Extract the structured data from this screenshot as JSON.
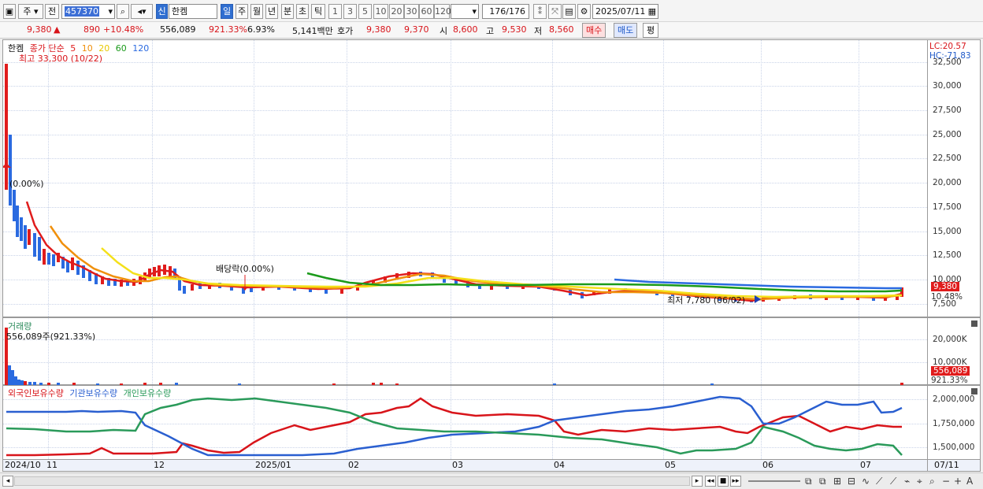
{
  "toolbar": {
    "period_label": "주",
    "prev_label": "전",
    "code_value": "457370",
    "credit_badge": "신",
    "stock_name": "한켐",
    "timeframes": [
      "일",
      "주",
      "월",
      "년",
      "분",
      "초",
      "틱"
    ],
    "intervals": [
      "1",
      "3",
      "5",
      "10",
      "20",
      "30",
      "60",
      "120"
    ],
    "count_value": "176",
    "count_total": "/176",
    "date_value": "2025/07/11"
  },
  "quote": {
    "price": "9,380",
    "change_arrow": "▲",
    "change": "890",
    "change_pct": "+10.48%",
    "volume": "556,089",
    "volume_pct": "921.33%",
    "turnover": "6.93%",
    "amount": "5,141백만",
    "bid_label": "호가",
    "bid1": "9,380",
    "bid2": "9,370",
    "open_label": "시",
    "open": "8,600",
    "high_label": "고",
    "high": "9,530",
    "low_label": "저",
    "low": "8,560",
    "buy_label": "매수",
    "sell_label": "매도",
    "eval_label": "평"
  },
  "price_panel": {
    "stock_name": "한켐",
    "ma_label": "종가 단순",
    "ma_periods": [
      "5",
      "10",
      "20",
      "60",
      "120"
    ],
    "ma_colors": [
      "#e01c1c",
      "#f0900c",
      "#f4e01a",
      "#1a9a1a",
      "#2a6ae0"
    ],
    "high_note": "최고 33,300 (10/22)",
    "pct_note": "(0.00%)",
    "dividend_note": "배당락(0.00%)",
    "low_note": "최저 7,780 (06/02)",
    "lc": "LC:20.57",
    "hc": "HC:-71.83",
    "current_price": "9,380",
    "current_pct": "10.48%",
    "y_ticks": [
      "32,500",
      "30,000",
      "27,500",
      "25,000",
      "22,500",
      "20,000",
      "17,500",
      "15,000",
      "12,500",
      "10,000",
      "7,500"
    ]
  },
  "volume_panel": {
    "title": "거래량",
    "note": "556,089주(921.33%)",
    "y_ticks": [
      "20,000K",
      "10,000K"
    ],
    "current": "556,089",
    "current_pct": "921.33%"
  },
  "holding_panel": {
    "legend": [
      {
        "label": "외국인보유수량",
        "color": "#d8141a"
      },
      {
        "label": "기관보유수량",
        "color": "#2a5fd0"
      },
      {
        "label": "개인보유수량",
        "color": "#2a9a5a"
      }
    ],
    "y_ticks": [
      "2,000,000",
      "1,750,000",
      "1,500,000"
    ]
  },
  "x_axis": {
    "labels": [
      "2024/10",
      "11",
      "12",
      "2025/01",
      "02",
      "03",
      "04",
      "05",
      "06",
      "07"
    ],
    "right_label": "07/11"
  },
  "chart_data": [
    {
      "type": "line",
      "title": "한켐",
      "series": [
        {
          "name": "5",
          "color": "#e01c1c"
        },
        {
          "name": "10",
          "color": "#f0900c"
        },
        {
          "name": "20",
          "color": "#f4e01a"
        },
        {
          "name": "60",
          "color": "#1a9a1a"
        },
        {
          "name": "120",
          "color": "#2a6ae0"
        }
      ],
      "x": [
        "2024/10",
        "11",
        "12",
        "2025/01",
        "02",
        "03",
        "04",
        "05",
        "06",
        "07"
      ],
      "ylim": [
        7000,
        33300
      ],
      "y_ticks": [
        7500,
        10000,
        12500,
        15000,
        17500,
        20000,
        22500,
        25000,
        27500,
        30000,
        32500
      ],
      "annotations": [
        "최고 33,300 (10/22)",
        "최저 7,780 (06/02)",
        "배당락(0.00%)"
      ]
    },
    {
      "type": "bar",
      "title": "거래량",
      "y_ticks": [
        "20,000K",
        "10,000K"
      ],
      "last_value": 556089
    },
    {
      "type": "line",
      "series": [
        {
          "name": "외국인보유수량",
          "color": "#d8141a"
        },
        {
          "name": "기관보유수량",
          "color": "#2a5fd0"
        },
        {
          "name": "개인보유수량",
          "color": "#2a9a5a"
        }
      ],
      "y_ticks": [
        1500000,
        1750000,
        2000000
      ]
    }
  ]
}
